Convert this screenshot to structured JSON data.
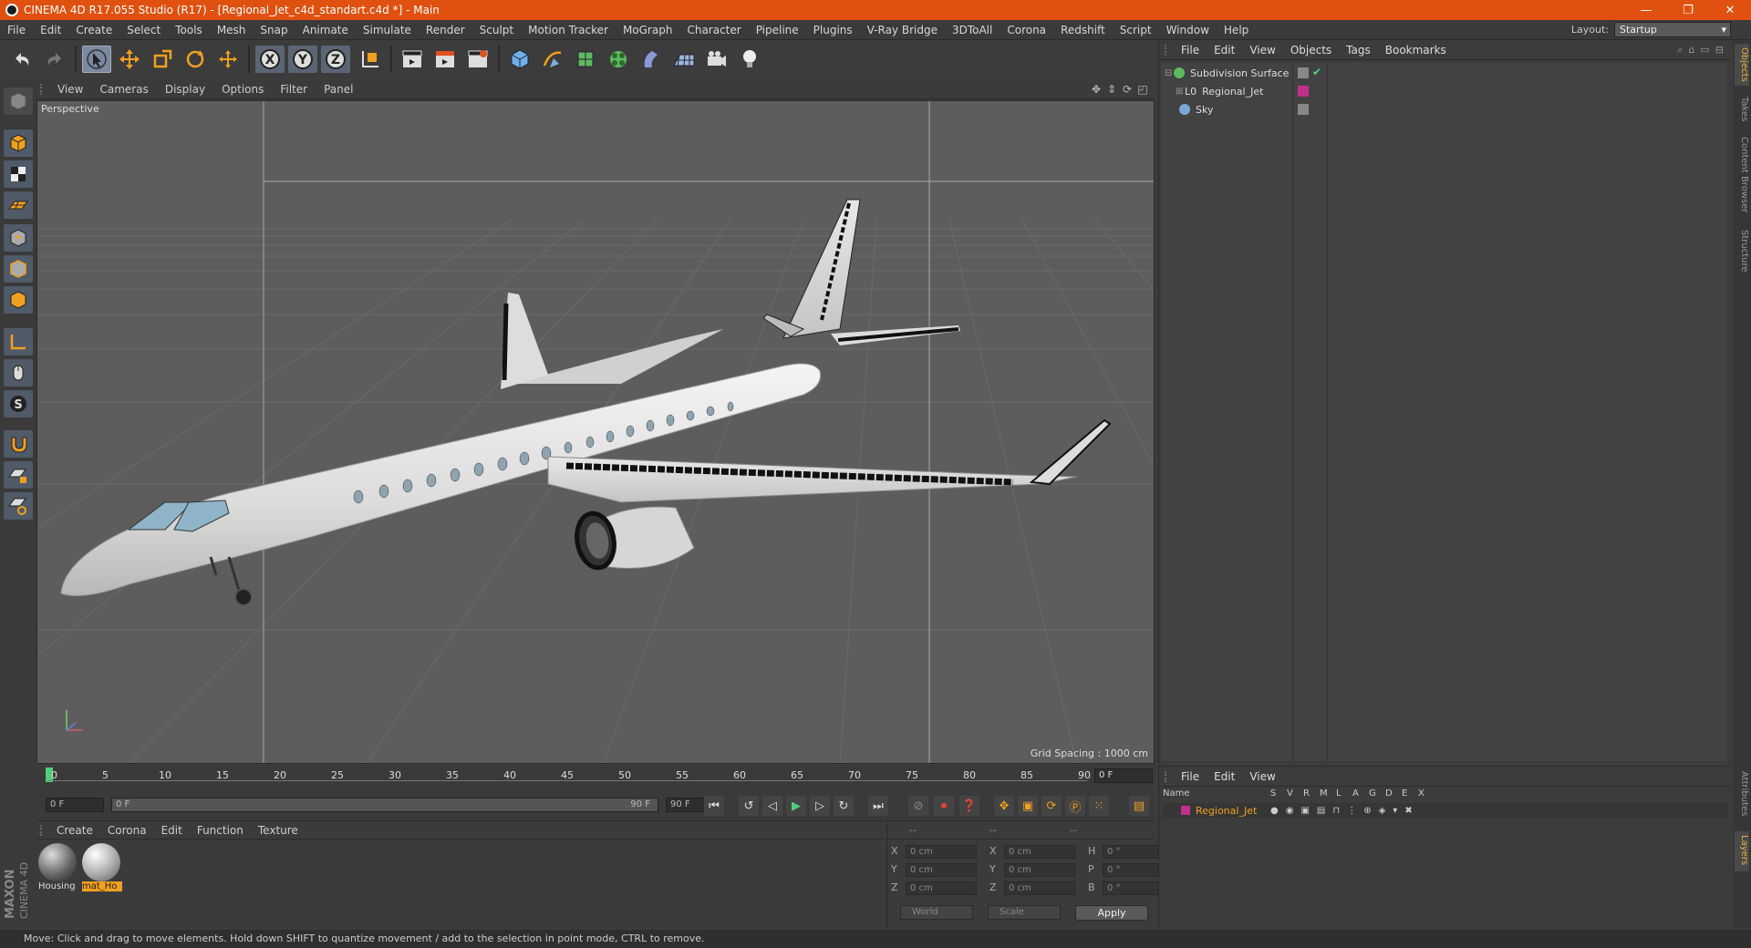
{
  "window": {
    "title": "CINEMA 4D R17.055 Studio (R17) - [Regional_Jet_c4d_standart.c4d *] - Main",
    "controls": [
      "—",
      "❐",
      "✕"
    ]
  },
  "menubar": [
    "File",
    "Edit",
    "Create",
    "Select",
    "Tools",
    "Mesh",
    "Snap",
    "Animate",
    "Simulate",
    "Render",
    "Sculpt",
    "Motion Tracker",
    "MoGraph",
    "Character",
    "Pipeline",
    "Plugins",
    "V-Ray Bridge",
    "3DToAll",
    "Corona",
    "Redshift",
    "Script",
    "Window",
    "Help"
  ],
  "layout": {
    "label": "Layout:",
    "value": "Startup"
  },
  "viewport": {
    "menu": [
      "View",
      "Cameras",
      "Display",
      "Options",
      "Filter",
      "Panel"
    ],
    "label": "Perspective",
    "grid_spacing": "Grid Spacing : 1000 cm"
  },
  "timeline": {
    "ticks": [
      "0",
      "5",
      "10",
      "15",
      "20",
      "25",
      "30",
      "35",
      "40",
      "45",
      "50",
      "55",
      "60",
      "65",
      "70",
      "75",
      "80",
      "85",
      "90"
    ],
    "current_frame": "0 F",
    "start_field": "0 F",
    "range_start": "0 F",
    "range_end": "90 F",
    "end_field": "90 F"
  },
  "materials": {
    "menu": [
      "Create",
      "Corona",
      "Edit",
      "Function",
      "Texture"
    ],
    "items": [
      {
        "label": "Housing",
        "selected": false
      },
      {
        "label": "mat_Ho",
        "selected": true
      }
    ]
  },
  "coordinates": {
    "headers": [
      "--",
      "--",
      "--"
    ],
    "rows": [
      {
        "a1": "X",
        "v1": "0 cm",
        "a2": "X",
        "v2": "0 cm",
        "a3": "H",
        "v3": "0 °"
      },
      {
        "a1": "Y",
        "v1": "0 cm",
        "a2": "Y",
        "v2": "0 cm",
        "a3": "P",
        "v3": "0 °"
      },
      {
        "a1": "Z",
        "v1": "0 cm",
        "a2": "Z",
        "v2": "0 cm",
        "a3": "B",
        "v3": "0 °"
      }
    ],
    "space": "World",
    "mode": "Scale",
    "apply": "Apply"
  },
  "objects": {
    "menu": [
      "File",
      "Edit",
      "View",
      "Objects",
      "Tags",
      "Bookmarks"
    ],
    "items": [
      {
        "name": "Subdivision Surface",
        "color": "#5fba5f"
      },
      {
        "name": "Regional_Jet",
        "color": "#c8c8c8"
      },
      {
        "name": "Sky",
        "color": "#7aa8d8"
      }
    ]
  },
  "layers": {
    "menu": [
      "File",
      "Edit",
      "View"
    ],
    "columns": [
      "Name",
      "S",
      "V",
      "R",
      "M",
      "L",
      "A",
      "G",
      "D",
      "E",
      "X"
    ],
    "row": {
      "name": "Regional_Jet",
      "color": "#c0308a"
    }
  },
  "side_tabs": [
    "Objects",
    "Takes",
    "Content Browser",
    "Structure",
    "Attributes",
    "Layers"
  ],
  "status": "Move: Click and drag to move elements. Hold down SHIFT to quantize movement / add to the selection in point mode, CTRL to remove.",
  "branding": {
    "maxon": "MAXON",
    "product": "CINEMA 4D"
  },
  "colors": {
    "titlebar": "#e0500f",
    "accent": "#f0a020"
  }
}
